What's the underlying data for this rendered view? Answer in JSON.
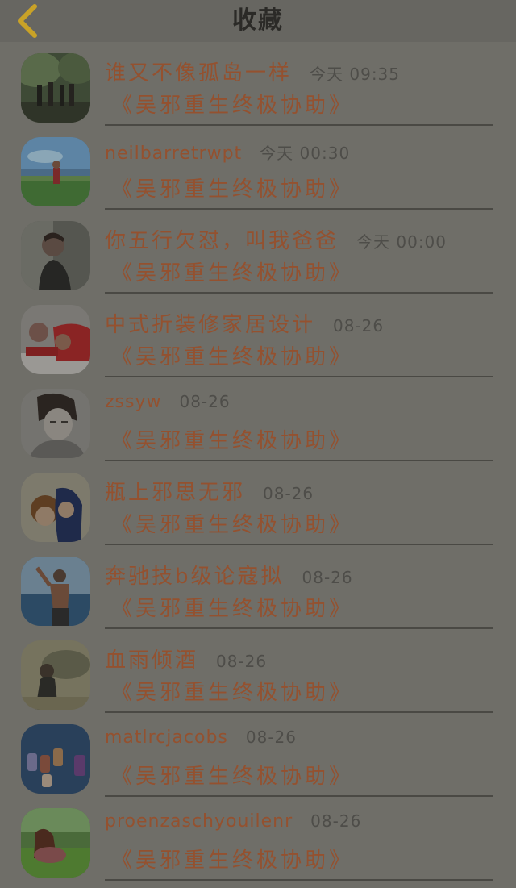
{
  "header": {
    "title": "收藏",
    "back_icon": "chevron-left-icon",
    "accent": "#c9a227"
  },
  "items": [
    {
      "name": "谁又不像孤岛一样",
      "time": "今天 09:35",
      "subtitle": "《吴邪重生终极协助》",
      "avatar": "forest-group-photo"
    },
    {
      "name": "neilbarretrwpt",
      "time": "今天 00:30",
      "subtitle": "《吴邪重生终极协助》",
      "avatar": "meadow-figure-photo"
    },
    {
      "name": "你五行欠怼，叫我爸爸",
      "time": "今天 00:00",
      "subtitle": "《吴邪重生终极协助》",
      "avatar": "dark-portrait-photo"
    },
    {
      "name": "中式折装修家居设计",
      "time": "08-26",
      "subtitle": "《吴邪重生终极协助》",
      "avatar": "couple-red-photo"
    },
    {
      "name": "zssyw",
      "time": "08-26",
      "subtitle": "《吴邪重生终极协助》",
      "avatar": "anime-boy-photo"
    },
    {
      "name": "瓶上邪思无邪",
      "time": "08-26",
      "subtitle": "《吴邪重生终极协助》",
      "avatar": "anime-couple-photo"
    },
    {
      "name": "奔驰技b级论寇拟",
      "time": "08-26",
      "subtitle": "《吴邪重生终极协助》",
      "avatar": "beach-man-photo"
    },
    {
      "name": "血雨倾酒",
      "time": "08-26",
      "subtitle": "《吴邪重生终极协助》",
      "avatar": "ink-figure-photo"
    },
    {
      "name": "matlrcjacobs",
      "time": "08-26",
      "subtitle": "《吴邪重生终极协助》",
      "avatar": "phone-cases-photo"
    },
    {
      "name": "proenzaschyouilenr",
      "time": "08-26",
      "subtitle": "《吴邪重生终极协助》",
      "avatar": "grass-girl-photo"
    }
  ]
}
